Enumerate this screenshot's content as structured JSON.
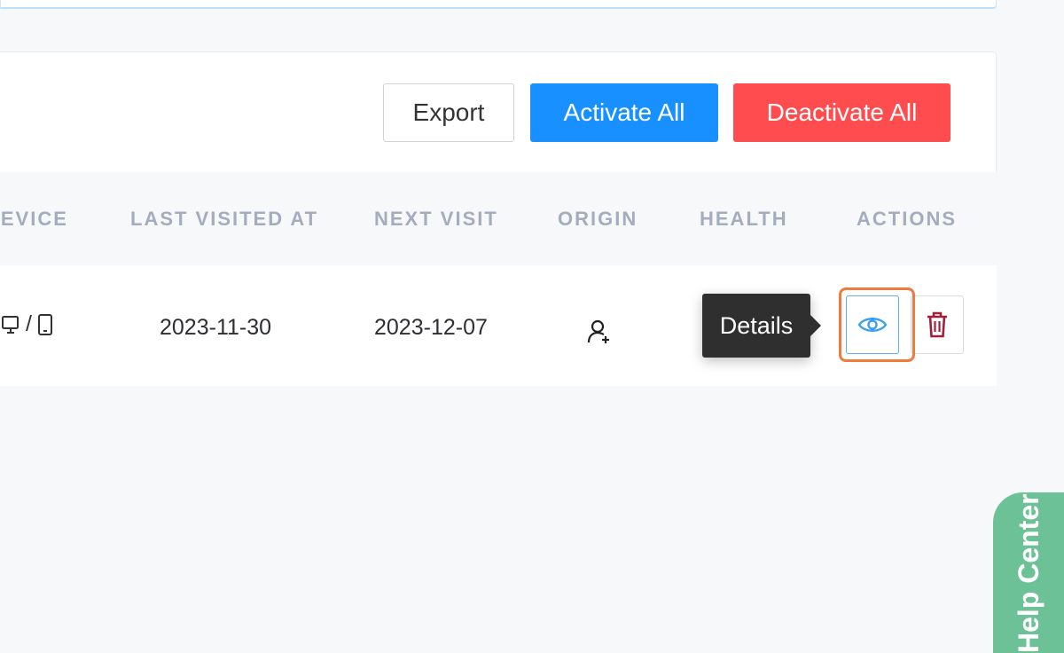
{
  "toolbar": {
    "export_label": "Export",
    "activate_all_label": "Activate All",
    "deactivate_all_label": "Deactivate All"
  },
  "table": {
    "headers": [
      "DEVICE",
      "LAST VISITED AT",
      "NEXT VISIT",
      "ORIGIN",
      "HEALTH",
      "ACTIONS"
    ],
    "rows": [
      {
        "device_separator": "/",
        "last_visited_at": "2023-11-30",
        "next_visit": "2023-12-07"
      }
    ]
  },
  "tooltip": {
    "text": "Details"
  },
  "help": {
    "label": "Help Center"
  },
  "colors": {
    "primary": "#1890ff",
    "danger": "#ff4d4f",
    "focus": "#f07b3f",
    "help": "#6cc197"
  },
  "icons": {
    "device_desktop": "monitor-icon",
    "device_mobile": "mobile-icon",
    "origin": "user-add-icon",
    "health": "health-icon",
    "view": "eye-icon",
    "delete": "trash-icon"
  }
}
